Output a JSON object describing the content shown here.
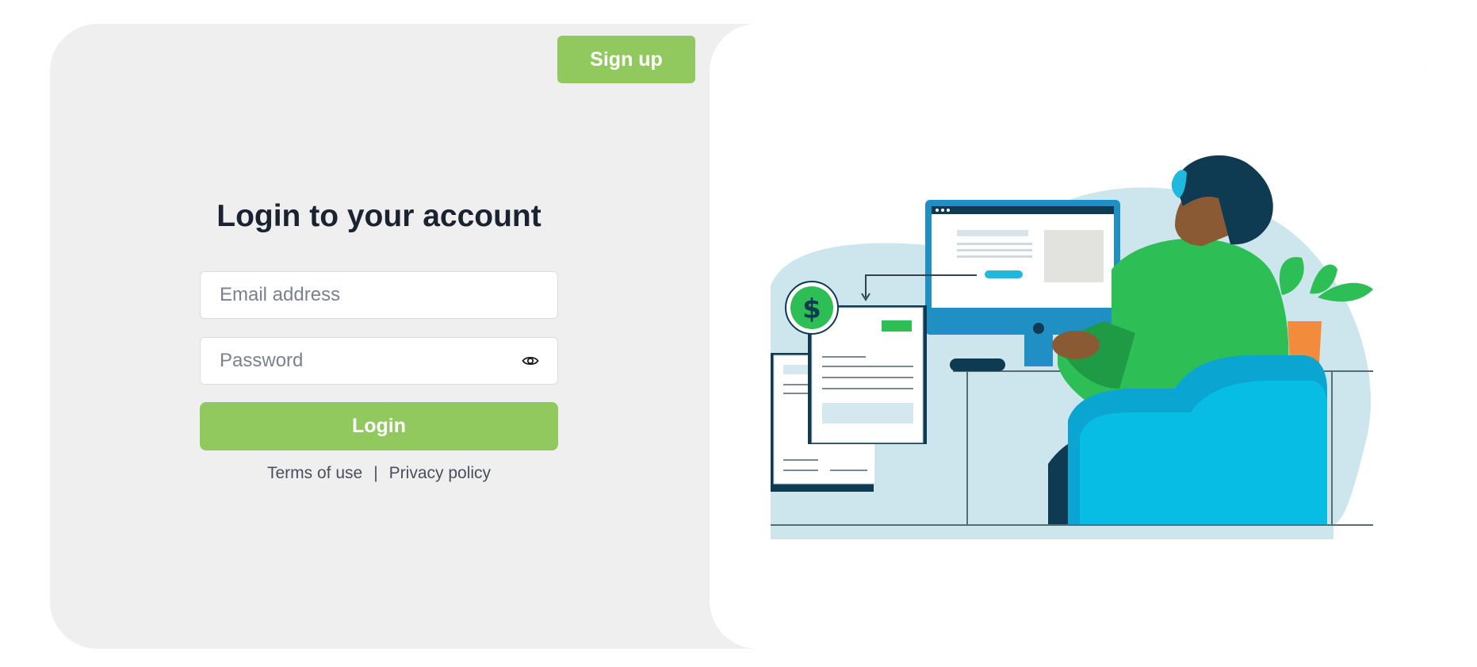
{
  "header": {
    "signup_label": "Sign up"
  },
  "login": {
    "title": "Login to your account",
    "email_placeholder": "Email address",
    "email_value": "",
    "password_placeholder": "Password",
    "password_value": "",
    "submit_label": "Login"
  },
  "footer_links": {
    "terms_label": "Terms of use",
    "separator": "|",
    "privacy_label": "Privacy policy"
  },
  "illustration": {
    "currency_symbol": "$"
  },
  "icons": {
    "password_toggle": "eye-icon"
  },
  "colors": {
    "accent": "#92c95f",
    "panel_bg": "#efefef",
    "title": "#1b2230"
  }
}
